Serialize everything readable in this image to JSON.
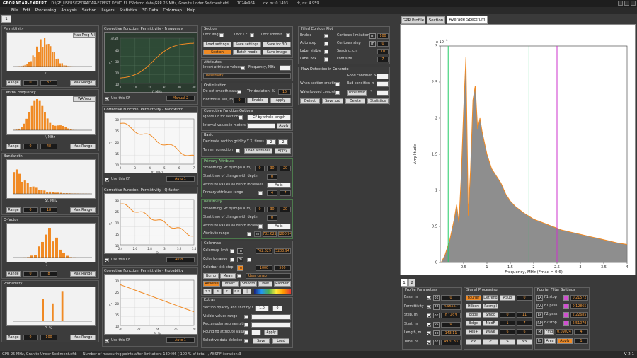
{
  "titlebar": {
    "app": "GEORADAR-EXPERT",
    "path": "D:\\GE_USERS\\GEORADAR-EXPERT DEMO FILES\\demo data\\GPR 25 MHz, Granite Under Sediment.efd",
    "size": "1024x964",
    "dx": "dx, m: 0.1493",
    "dt": "dt, ns: 4.959"
  },
  "menu": [
    "File",
    "Edit",
    "Processing",
    "Analysis",
    "Section",
    "Layers",
    "Statistics",
    "3D Data",
    "Colormap",
    "Help"
  ],
  "doc_tab": "1",
  "histograms": [
    {
      "title": "Permittivity",
      "xlabel": "ε'",
      "btn_left": "Range",
      "v1": "0",
      "v2": "82",
      "btn_right": "Max Range",
      "btn_top": "Max Prng All"
    },
    {
      "title": "Central Frequency",
      "xlabel": "f, MHz",
      "btn_left": "Range",
      "v1": "0",
      "v2": "48",
      "btn_right": "Max Range",
      "btn_top": "WAFreq"
    },
    {
      "title": "Bandwidth",
      "xlabel": "Δf, MHz",
      "btn_left": "Range",
      "v1": "0",
      "v2": "18",
      "btn_right": "Max Range",
      "btn_top": ""
    },
    {
      "title": "Q-factor",
      "xlabel": "Q",
      "btn_left": "Range",
      "v1": "0",
      "v2": "8",
      "btn_right": "Max Range",
      "btn_top": ""
    },
    {
      "title": "Probability",
      "xlabel": "P, %",
      "btn_left": "Range",
      "v1": "0",
      "v2": "100",
      "btn_right": "Max Range",
      "btn_top": ""
    }
  ],
  "cf_panels": [
    {
      "title": "Corrective Function: Permittivity - Frequency",
      "xlabel": "f, MHz",
      "ylabel": "ε'",
      "use": "Use this CF",
      "mode": "Manual 2",
      "ticks_x": [
        "0",
        "10",
        "20",
        "30",
        "40",
        "48"
      ],
      "ticks_y": [
        "45.61",
        "40",
        "30",
        "20",
        "10"
      ]
    },
    {
      "title": "Corrective Function: Permittivity - Bandwidth",
      "xlabel": "Δf, MHz",
      "ylabel": "ε'",
      "use": "Use this CF",
      "mode": "Auto 1",
      "ticks_x": [
        "2",
        "3",
        "4",
        "5",
        "6",
        "7"
      ],
      "ticks_y": [
        "30",
        "25",
        "20",
        "15",
        "10"
      ]
    },
    {
      "title": "Corrective Function: Permittivity - Q-factor",
      "xlabel": "Q",
      "ylabel": "ε'",
      "use": "Use this CF",
      "mode": "Auto 1",
      "ticks_x": [
        "2.4",
        "2.6",
        "2.8",
        "3",
        "3.2",
        "3.4"
      ],
      "ticks_y": [
        "30",
        "25",
        "20",
        "15",
        "10"
      ]
    },
    {
      "title": "Corrective Function: Permittivity - Probability",
      "xlabel": "P, %",
      "ylabel": "ε'",
      "use": "Use this CF",
      "mode": "Auto 1",
      "ticks_x": [
        "70",
        "72",
        "74",
        "76",
        "78"
      ],
      "ticks_y": [
        "30",
        "25",
        "20",
        "15",
        "10"
      ]
    }
  ],
  "section": {
    "title": "Section",
    "lock_img": "Lock img",
    "lock_cf": "Lock CF",
    "lock_smooth": "Lock smooth",
    "load_settings": "Load settings",
    "save_settings": "Save settings",
    "save_3d": "Save for 3D",
    "section_btn": "Section",
    "batch": "Batch mode",
    "save_image": "Save image"
  },
  "attributes": {
    "title": "Attributes",
    "invert": "Invert attribute values",
    "freq": "Frequency, MHz",
    "value": "Resistivity"
  },
  "optimization": {
    "title": "Optimization",
    "no_smooth": "Do not smooth data",
    "thr": "Thr deviation, %",
    "thr_val": "15",
    "hwin": "Horizontal win, m",
    "hwin_val": "0",
    "enable": "Enable",
    "apply": "Apply"
  },
  "cf_options": {
    "title": "Corrective Function Options",
    "ignore": "Ignore CF for section",
    "mode": "CF by whole length",
    "interval": "Interval values in meters",
    "apply": "Apply"
  },
  "basic": {
    "title": "Basic",
    "decimate": "Decimate section grid by Y X, times",
    "d1": "2",
    "d2": "2",
    "terrain": "Terrain correction",
    "load_alt": "Load altitudes",
    "apply": "Apply"
  },
  "primary": {
    "title": "Primary Attribute",
    "smooth": "Smoothing, RF Y(smpl) X(m)",
    "s1": "0",
    "s2": "30",
    "s3": "20",
    "start": "Start time of change with depth",
    "start_val": "0",
    "depth": "Attribute values as depth increases",
    "depth_val": "As is",
    "range": "Primary attribute range",
    "r1": "4",
    "r2": "7"
  },
  "resistivity": {
    "title": "Resistivity",
    "smooth": "Smoothing, RF Y(smpl) X(m)",
    "s1": "0",
    "s2": "30",
    "s3": "20",
    "start": "Start time of change with depth",
    "start_val": "0",
    "depth": "Attribute values as depth increases",
    "depth_val": "As is",
    "range": "Attribute range",
    "r1": "782.629",
    "r2": "5200.94"
  },
  "colormap": {
    "title": "Colormap",
    "limit": "Colormap limit",
    "lim1": "762.629",
    "lim2": "5200.94",
    "to_range": "Color to range",
    "tick": "Colorbar tick step",
    "tick1": "1000",
    "tick2": "500",
    "bump": "Bump",
    "mean": "Mean",
    "user": "User cmap",
    "reverse": "Reverse",
    "invert": "Invert",
    "smooth": "Smooth",
    "pow": "Pow",
    "random": "Random",
    "nav": [
      "<<",
      "<",
      ">",
      ">>",
      "|"
    ]
  },
  "extras": {
    "title": "Extras",
    "opacity": "Section opacity and shift by Y",
    "op1": "1.0",
    "op2": "0",
    "visible": "Visible values range",
    "rect": "Rectangular segmentation",
    "round": "Rounding attribute values",
    "apply": "Apply",
    "selective": "Selective data deletion",
    "save": "Save",
    "load": "Load"
  },
  "contour": {
    "title": "Filled Contour Plot",
    "enable": "Enable",
    "limitation": "Contours limitation",
    "lim_val": "100",
    "auto": "Auto step",
    "step": "Contours step",
    "step_val": "0",
    "visible": "Label visible",
    "spacing": "Spacing, cm",
    "sp_val": "10",
    "box": "Label box",
    "font": "Font size",
    "font_val": "7"
  },
  "flaw": {
    "title": "Flaw Detection in Concrete",
    "good": "Good condition >",
    "bad": "Bad condition <",
    "when": "When section creating",
    "water": "Waterlogged concrete",
    "threshold": "Threshold",
    "detect": "Detect",
    "save": "Save xzd",
    "delete": "Delete",
    "stats": "Statistics"
  },
  "right_tabs": [
    "GPR Profile",
    "Section",
    "Average Spectrum"
  ],
  "spectrum": {
    "ylabel": "Amplitude",
    "xlabel": "Frequency, MHz (Fmax = 0.6)",
    "exp": "x 10",
    "exp_sup": "4",
    "yticks": [
      "0",
      "0.5",
      "1",
      "1.5",
      "2",
      "2.5",
      "3"
    ],
    "xticks": [
      "0.5",
      "1",
      "1.5",
      "2",
      "2.5",
      "3",
      "3.5",
      "4"
    ]
  },
  "chart_data": {
    "type": "area",
    "title": "",
    "xlabel": "Frequency, MHz (Fmax = 0.6)",
    "ylabel": "Amplitude",
    "xlim": [
      0,
      4
    ],
    "ylim": [
      0,
      30000
    ],
    "x": [
      0.02,
      0.1,
      0.2,
      0.3,
      0.35,
      0.4,
      0.45,
      0.5,
      0.55,
      0.6,
      0.65,
      0.7,
      0.75,
      0.8,
      0.85,
      0.9,
      1.0,
      1.1,
      1.2,
      1.3,
      1.4,
      1.5,
      1.6,
      1.8,
      2.0,
      2.2,
      2.4,
      2.6,
      2.8,
      3.0,
      3.2,
      3.4,
      3.6,
      3.8,
      4.0
    ],
    "values": [
      0,
      1000,
      3000,
      6000,
      8000,
      5500,
      12000,
      21000,
      28500,
      6500,
      13000,
      22500,
      24500,
      18500,
      20000,
      18000,
      15000,
      13000,
      12000,
      11000,
      9500,
      8500,
      7800,
      6800,
      6000,
      5500,
      5000,
      4500,
      4200,
      3900,
      3600,
      3300,
      3000,
      2700,
      2500
    ],
    "markers": [
      {
        "x": 0.17,
        "color": "#22cc66"
      },
      {
        "x": 0.25,
        "color": "#cc33cc"
      },
      {
        "x": 1.9,
        "color": "#22cc66"
      },
      {
        "x": 2.5,
        "color": "#cc33cc"
      }
    ]
  },
  "bottom_tabs": [
    "1",
    "2"
  ],
  "profile_params": {
    "title": "Profile Parameters",
    "rows": [
      {
        "label": "Base, m",
        "v": "0"
      },
      {
        "label": "Permittivity",
        "v": "4.96567"
      },
      {
        "label": "Step, m",
        "v": "0.1493"
      },
      {
        "label": "Start, m",
        "v": "0"
      },
      {
        "label": "Length, m",
        "v": "143.11"
      },
      {
        "label": "Time, ns",
        "v": "4970.83"
      }
    ],
    "btn": "ok"
  },
  "signal": {
    "title": "Signal Processing",
    "r1": [
      "Fourier",
      "Detrend",
      "ASub",
      "0"
    ],
    "r2": [
      "Hilbert",
      "Resmpl",
      "",
      ""
    ],
    "r3": [
      "Edge",
      "Smoo",
      "0",
      "11"
    ],
    "r4": [
      "Edge",
      "MedF",
      "1",
      "7"
    ],
    "r5": [
      "Res+",
      "Wave",
      "6",
      "6"
    ],
    "nav": [
      "<<",
      "<",
      ">",
      ">>"
    ]
  },
  "fourier": {
    "title": "Fourier Filter Settings",
    "rows": [
      {
        "k": "LA",
        "l": "F1 stop",
        "v": "0.21572"
      },
      {
        "k": "RA",
        "l": "F1 pass",
        "v": "0.12865"
      },
      {
        "k": "LP",
        "l": "F2 pass",
        "v": "2.22685"
      },
      {
        "k": "RP",
        "l": "F2 stop",
        "v": "2.51079"
      }
    ],
    "m": "M",
    "freq": "Fmg",
    "fval": "0.09024",
    "four": "4",
    "fa": "Fa",
    "area": "Area",
    "apply": "Apply",
    "one": "1"
  },
  "status": {
    "file": "GPR 25 MHz, Granite Under Sediment.efd:",
    "measure": "Number of measuring points after limitation: 130406  ( 100 % of total ),  ABSRF iteration:3"
  },
  "version": "V 2.1"
}
